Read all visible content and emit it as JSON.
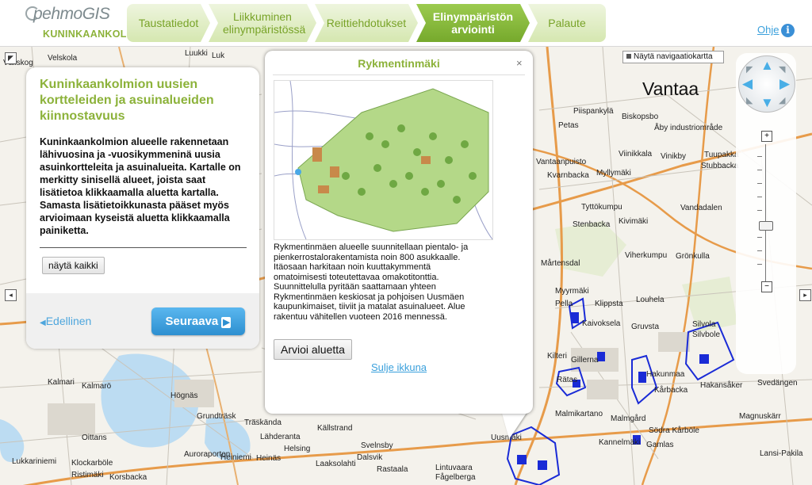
{
  "header": {
    "logo_main": "pehmoGIS",
    "logo_sub": "KUNINKAANKOLMIO",
    "steps": [
      {
        "label": "Taustatiedot",
        "active": false
      },
      {
        "label": "Liikkuminen elinympäristössä",
        "active": false
      },
      {
        "label": "Reittiehdotukset",
        "active": false
      },
      {
        "label": "Elinympäristön arviointi",
        "active": true
      },
      {
        "label": "Palaute",
        "active": false
      }
    ],
    "help_label": "Ohje",
    "help_icon": "info-icon"
  },
  "map": {
    "navmap_button": "Näytä navigaatiokartta",
    "city_label": "Vantaa",
    "place_labels": [
      "Velskola",
      "Luukki",
      "Luk",
      "Vällskog",
      "Piispankylä",
      "Biskopsbo",
      "Petas",
      "Åby industriområde",
      "Viinikkala",
      "Vinikby",
      "Tuupakka",
      "Stubbacka",
      "Vantaanpuisto",
      "Kvarnbacka",
      "Myllymäki",
      "Vandadalen",
      "Tyttökumpu",
      "Kivimäki",
      "Stenbacka",
      "Viherkumpu",
      "Grönkulla",
      "Mårtensdal",
      "Myyrmäki",
      "Pella",
      "Klippsta",
      "Louhela",
      "Kaivoksela",
      "Gruvsta",
      "Silvola",
      "Silvbole",
      "Kilteri",
      "Gillerna",
      "Rätas",
      "Hakunmaa",
      "Kårbacka",
      "Hakansåker",
      "Svedängen",
      "Kalmari",
      "Kalmarö",
      "Högnäs",
      "Grundträsk",
      "Träskända",
      "Lähderanta",
      "Källstrand",
      "Svelnsby",
      "Magnuskärr",
      "Malmgård",
      "Södra Kårböle",
      "Kannelmäki",
      "Gamlas",
      "Uusmäki",
      "Malmikartano",
      "Oittans",
      "Auroraporten",
      "Heiniemi",
      "Heinäs",
      "Helsing",
      "Dalsvik",
      "Laaksolahti",
      "Lukkariniemi",
      "Klockarböle",
      "Ristimäki",
      "Korsbacka",
      "Lintuvaara",
      "Fågelberga",
      "Rastaala",
      "Lansi-Pakila"
    ],
    "pan_icons": [
      "pan-up-left-icon",
      "pan-left-icon",
      "pan-right-icon"
    ],
    "zoom_in": "+",
    "zoom_out": "−",
    "zoom_level": 0.42
  },
  "left_panel": {
    "title": "Kuninkaankolmion uusien kortteleiden ja asuinalueiden kiinnostavuus",
    "description": "Kuninkaankolmion alueelle rakennetaan lähivuosina ja -vuosikymmeninä uusia asuinkortteleita ja asuinalueita. Kartalle on merkitty sinisellä alueet, joista saat lisätietoa klikkaamalla aluetta kartalla. Samasta lisätietoikkunasta pääset myös arvioimaan kyseistä aluetta klikkaamalla painiketta.",
    "show_all_button": "näytä kaikki",
    "prev_label": "Edellinen",
    "next_label": "Seuraava"
  },
  "popup": {
    "title": "Rykmentinmäki",
    "close_label": "×",
    "text": "Rykmentinmäen alueelle suunnitellaan pientalo- ja pienkerrostalorakentamista noin 800 asukkaalle. Itäosaan harkitaan noin kuuttakymmentä omatoimisesti toteutettavaa omakotitonttia. Suunnittelulla pyritään saattamaan yhteen Rykmentinmäen keskiosat ja pohjoisen Uusmäen kaupunkimaiset, tiiviit ja matalat asuinalueet. Alue rakentuu vähitellen vuoteen 2016 mennessä.",
    "rate_button": "Arvioi aluetta",
    "close_window_link": "Sulje ikkuna"
  },
  "colors": {
    "accent_green": "#8cb23a",
    "active_step": "#76a92c",
    "link_blue": "#3aa0dc",
    "area_outline": "#1a2bd6"
  }
}
